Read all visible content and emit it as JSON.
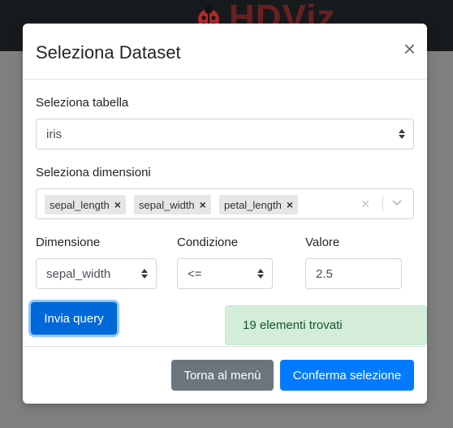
{
  "app": {
    "logo_text": "HDViz"
  },
  "modal": {
    "title": "Seleziona Dataset",
    "close_label": "×",
    "table_label": "Seleziona tabella",
    "table_value": "iris",
    "dims_label": "Seleziona dimensioni",
    "chips": [
      "sepal_length",
      "sepal_width",
      "petal_length"
    ],
    "chip_remove": "×",
    "clear_label": "×",
    "filter": {
      "dimension_label": "Dimensione",
      "dimension_value": "sepal_width",
      "condition_label": "Condizione",
      "condition_value": "<=",
      "value_label": "Valore",
      "value": "2.5"
    },
    "query_button": "Invia query",
    "result_message": "19 elementi trovati",
    "back_button": "Torna al menù",
    "confirm_button": "Conferma selezione"
  }
}
